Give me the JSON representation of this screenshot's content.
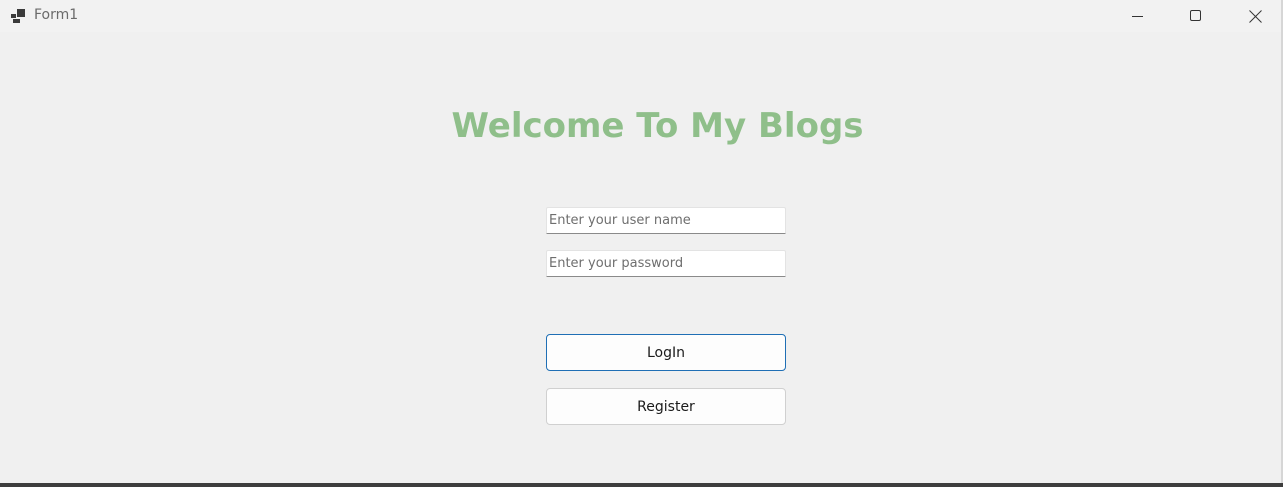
{
  "window": {
    "title": "Form1"
  },
  "main": {
    "heading": "Welcome To My Blogs",
    "heading_color": "#8fbf8a",
    "username": {
      "value": "",
      "placeholder": "Enter your user name"
    },
    "password": {
      "value": "",
      "placeholder": "Enter your password"
    },
    "login_label": "LogIn",
    "register_label": "Register",
    "accent_color": "#1f6fb5"
  },
  "icons": {
    "app": "app-form-icon",
    "minimize": "minimize-icon",
    "maximize": "maximize-icon",
    "close": "close-icon"
  }
}
